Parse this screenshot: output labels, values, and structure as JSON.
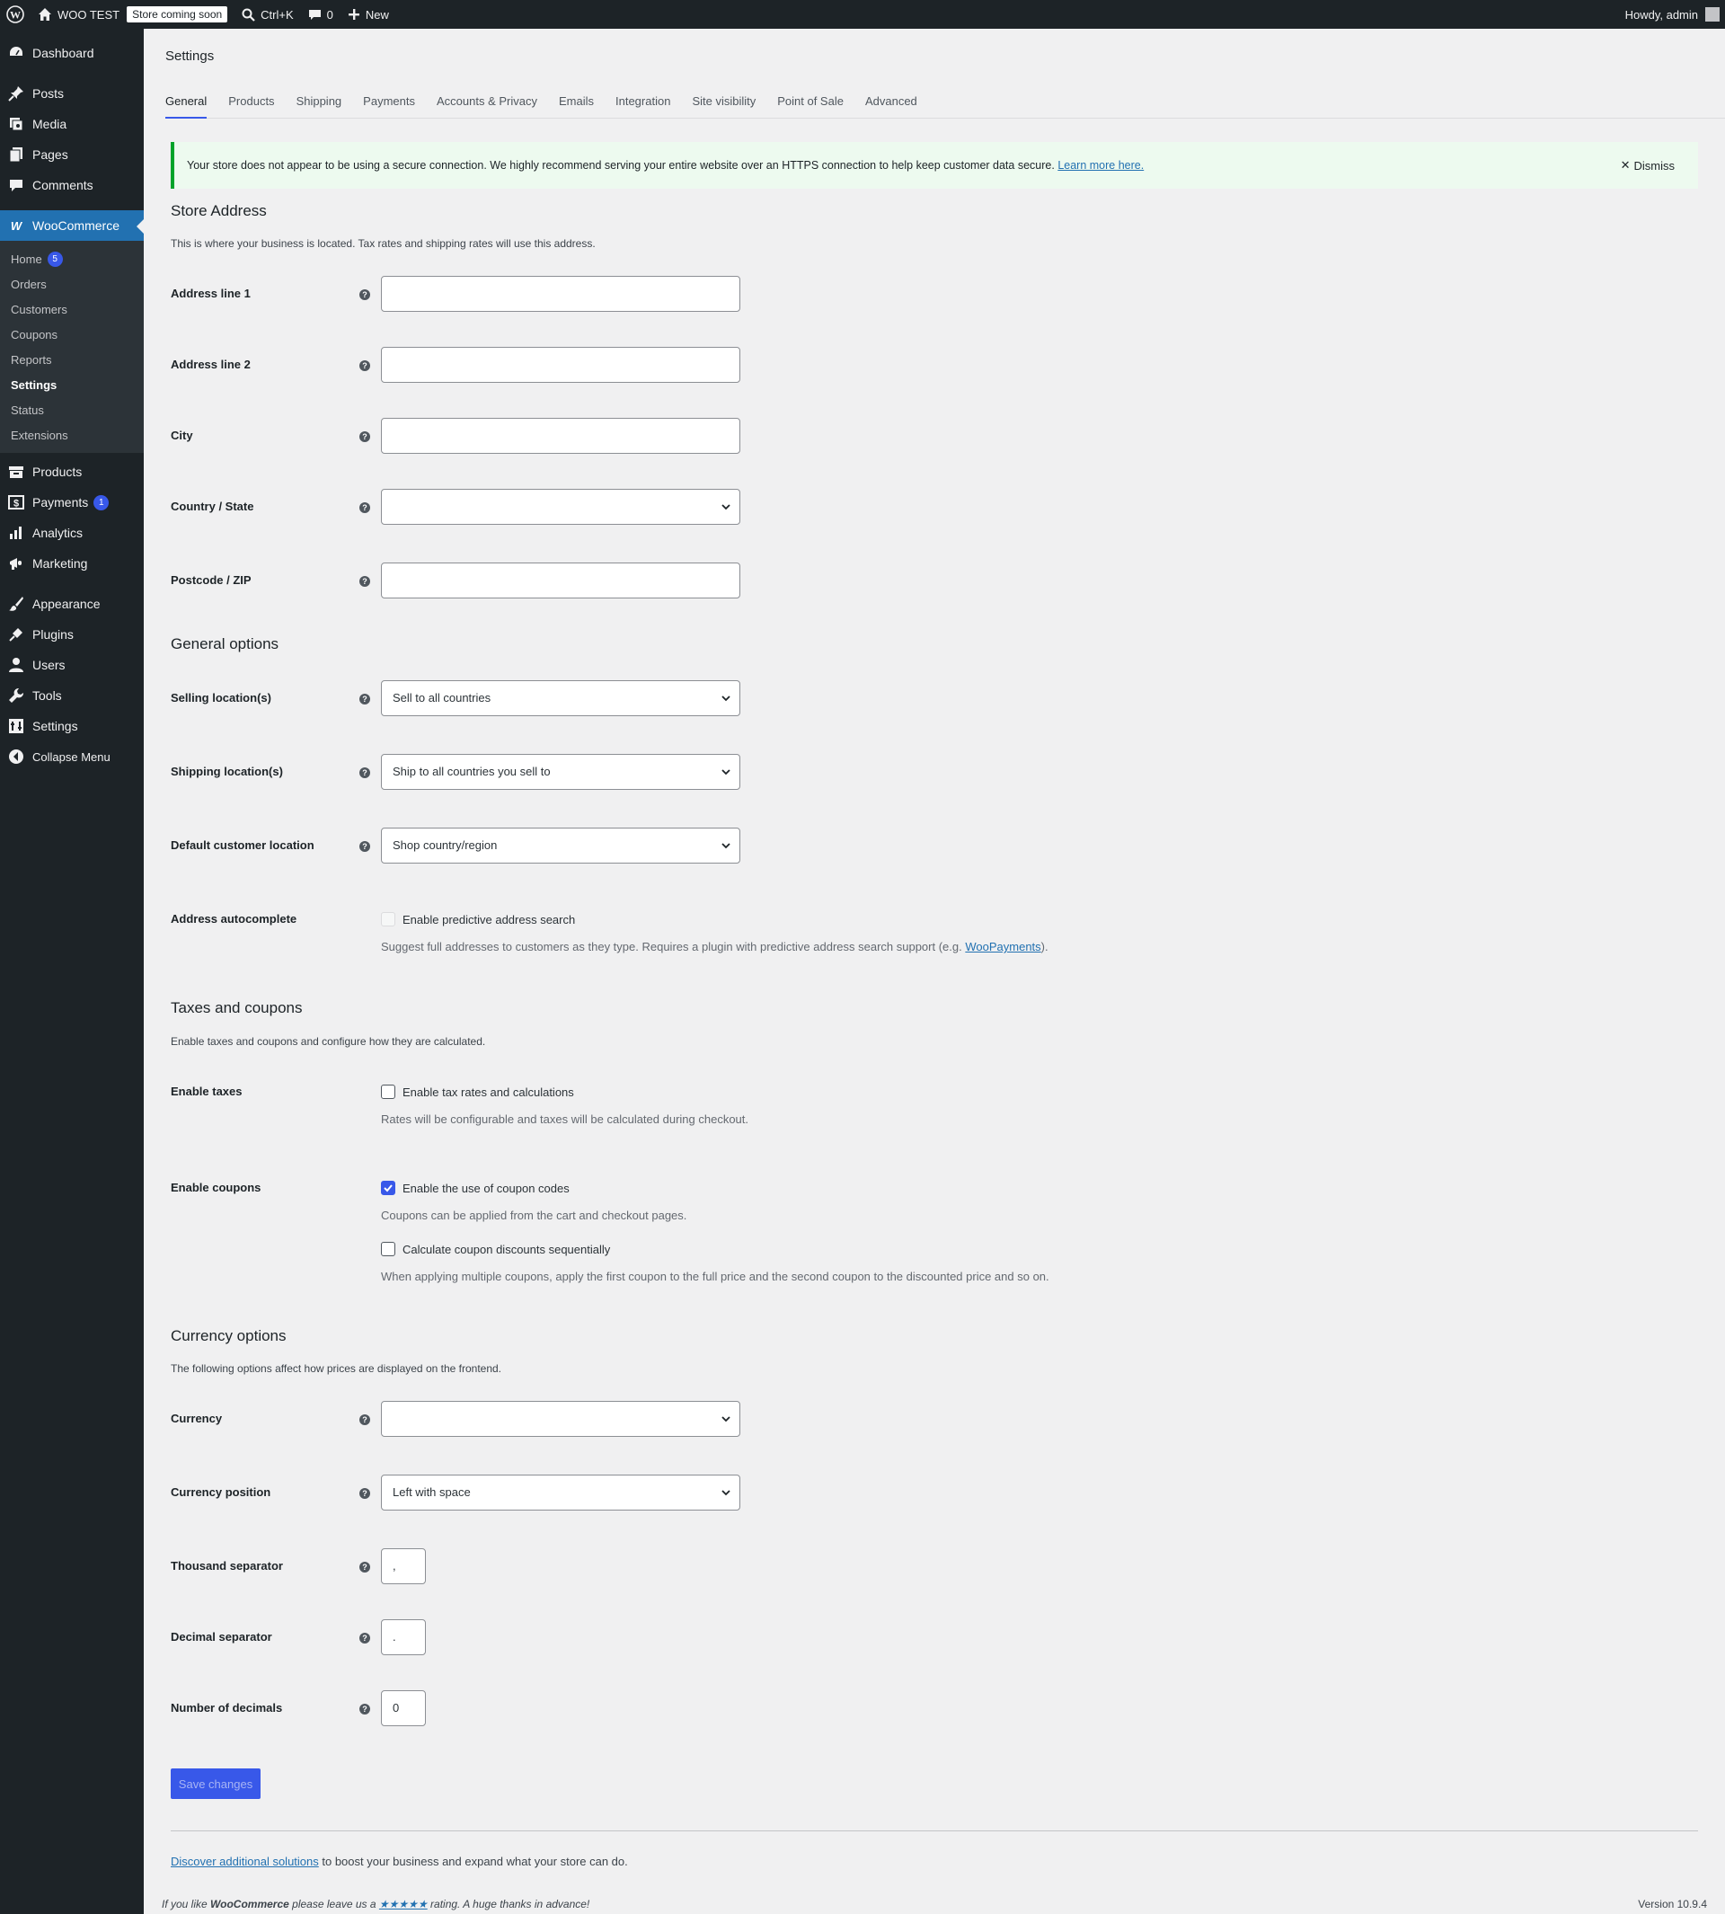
{
  "adminbar": {
    "site_name": "WOO TEST",
    "coming_soon": "Store coming soon",
    "search_shortcut": "Ctrl+K",
    "comments_count": "0",
    "new_label": "New",
    "howdy": "Howdy, admin"
  },
  "sidebar": {
    "dashboard": "Dashboard",
    "posts": "Posts",
    "media": "Media",
    "pages": "Pages",
    "comments": "Comments",
    "woocommerce": "WooCommerce",
    "sub": {
      "home": "Home",
      "home_badge": "5",
      "orders": "Orders",
      "customers": "Customers",
      "coupons": "Coupons",
      "reports": "Reports",
      "settings": "Settings",
      "status": "Status",
      "extensions": "Extensions"
    },
    "products": "Products",
    "payments": "Payments",
    "payments_badge": "1",
    "analytics": "Analytics",
    "marketing": "Marketing",
    "appearance": "Appearance",
    "plugins": "Plugins",
    "users": "Users",
    "tools": "Tools",
    "settings": "Settings",
    "collapse": "Collapse Menu"
  },
  "page": {
    "title": "Settings",
    "tabs": [
      "General",
      "Products",
      "Shipping",
      "Payments",
      "Accounts & Privacy",
      "Emails",
      "Integration",
      "Site visibility",
      "Point of Sale",
      "Advanced"
    ],
    "active_tab": "General"
  },
  "notice": {
    "message": "Your store does not appear to be using a secure connection. We highly recommend serving your entire website over an HTTPS connection to help keep customer data secure.",
    "link": "Learn more here.",
    "dismiss": "Dismiss"
  },
  "store_address": {
    "title": "Store Address",
    "description": "This is where your business is located. Tax rates and shipping rates will use this address.",
    "address1_label": "Address line 1",
    "address1_value": "",
    "address2_label": "Address line 2",
    "address2_value": "",
    "city_label": "City",
    "city_value": "",
    "country_label": "Country / State",
    "country_value": "",
    "postcode_label": "Postcode / ZIP",
    "postcode_value": ""
  },
  "general_options": {
    "title": "General options",
    "selling_label": "Selling location(s)",
    "selling_value": "Sell to all countries",
    "shipping_label": "Shipping location(s)",
    "shipping_value": "Ship to all countries you sell to",
    "default_loc_label": "Default customer location",
    "default_loc_value": "Shop country/region",
    "autocomplete_label": "Address autocomplete",
    "autocomplete_check": "Enable predictive address search",
    "autocomplete_desc_pre": "Suggest full addresses to customers as they type. Requires a plugin with predictive address search support (e.g.",
    "autocomplete_desc_link": "WooPayments",
    "autocomplete_desc_post": ")."
  },
  "taxes": {
    "title": "Taxes and coupons",
    "description": "Enable taxes and coupons and configure how they are calculated.",
    "taxes_label": "Enable taxes",
    "taxes_check": "Enable tax rates and calculations",
    "taxes_checked": false,
    "taxes_desc": "Rates will be configurable and taxes will be calculated during checkout.",
    "coupons_label": "Enable coupons",
    "coupons_check": "Enable the use of coupon codes",
    "coupons_checked": true,
    "coupons_desc": "Coupons can be applied from the cart and checkout pages.",
    "sequential_check": "Calculate coupon discounts sequentially",
    "sequential_checked": false,
    "sequential_desc": "When applying multiple coupons, apply the first coupon to the full price and the second coupon to the discounted price and so on."
  },
  "currency": {
    "title": "Currency options",
    "description": "The following options affect how prices are displayed on the frontend.",
    "currency_label": "Currency",
    "currency_value": "",
    "position_label": "Currency position",
    "position_value": "Left with space",
    "thousand_label": "Thousand separator",
    "thousand_value": ",",
    "decimal_label": "Decimal separator",
    "decimal_value": ".",
    "decimals_label": "Number of decimals",
    "decimals_value": "0"
  },
  "actions": {
    "save": "Save changes"
  },
  "footer": {
    "discover_link": "Discover additional solutions",
    "discover_text": " to boost your business and expand what your store can do.",
    "rate_pre": "If you like ",
    "rate_brand": "WooCommerce",
    "rate_mid": " please leave us a ",
    "rate_stars": "★★★★★",
    "rate_post": " rating. A huge thanks in advance!",
    "version": "Version 10.9.4"
  },
  "colors": {
    "accent": "#3858e9",
    "adminbar_bg": "#1d2327",
    "notice_border": "#00a32a"
  }
}
